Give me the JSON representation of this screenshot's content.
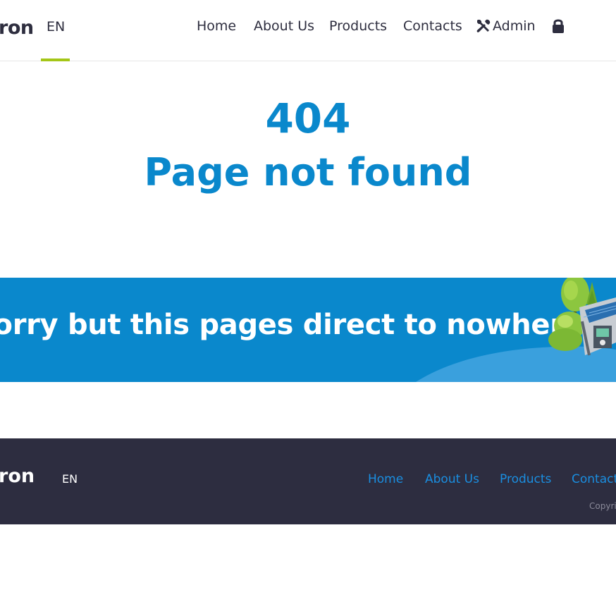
{
  "header": {
    "logo_text": "ron",
    "language": "EN",
    "nav": {
      "home": "Home",
      "about": "About Us",
      "products": "Products",
      "contacts": "Contacts",
      "admin": "Admin"
    }
  },
  "error": {
    "code": "404",
    "title": "Page not found"
  },
  "banner": {
    "message": "Sorry but this pages direct to nowhere!"
  },
  "footer": {
    "logo_text": "ron",
    "language": "EN",
    "nav": {
      "home": "Home",
      "about": "About Us",
      "products": "Products",
      "contacts": "Contacts"
    },
    "copyright": "Copyright"
  },
  "colors": {
    "accent_blue": "#0a88cc",
    "accent_green": "#a4c617",
    "footer_bg": "#2d2d40",
    "footer_link": "#1a8ee0"
  },
  "icons": [
    "tools-icon",
    "lock-icon",
    "solar-station-illustration"
  ]
}
